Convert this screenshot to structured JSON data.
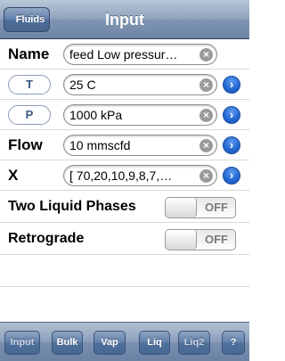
{
  "nav": {
    "back_label": "Fluids",
    "title": "Input"
  },
  "form": {
    "name": {
      "label": "Name",
      "value": "feed Low pressur…"
    },
    "T": {
      "label": "T",
      "value": "25 C"
    },
    "P": {
      "label": "P",
      "value": "1000 kPa"
    },
    "flow": {
      "label": "Flow",
      "value": "10 mmscfd"
    },
    "x": {
      "label": "X",
      "value": "[ 70,20,10,9,8,7,…"
    }
  },
  "switches": {
    "two_liquid": {
      "label": "Two Liquid Phases",
      "state": "OFF"
    },
    "retrograde": {
      "label": "Retrograde",
      "state": "OFF"
    }
  },
  "icons": {
    "clear": "×",
    "disclosure": "›"
  },
  "toolbar": {
    "input": "Input",
    "bulk": "Bulk",
    "vap": "Vap",
    "liq": "Liq",
    "liq2": "Liq2",
    "help": "?"
  },
  "colors": {
    "nav_bar": "#7f95b3",
    "accent_blue": "#2266d1",
    "pill_text": "#3a5a85"
  }
}
